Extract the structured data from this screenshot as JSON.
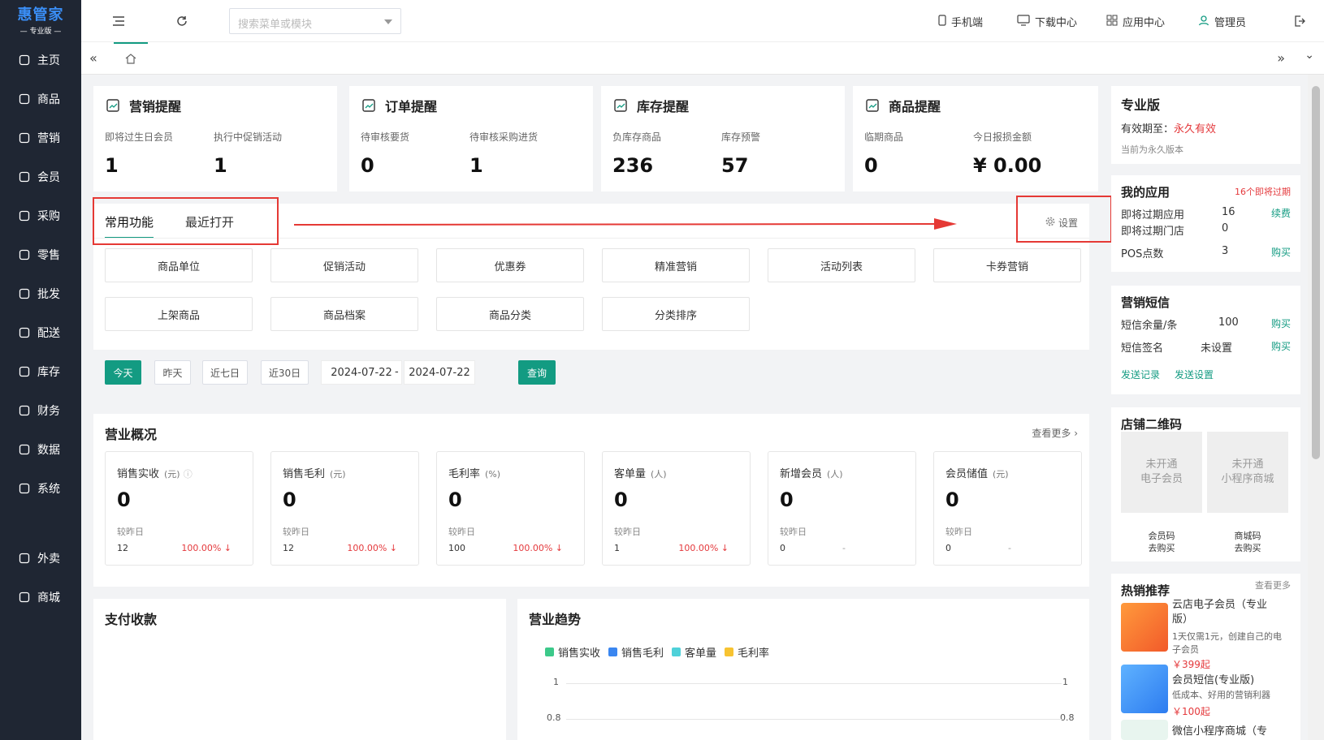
{
  "logo": {
    "brand": "惠管家",
    "edition": "专业版"
  },
  "nav": [
    {
      "label": "主页",
      "icon": "home-icon"
    },
    {
      "label": "商品",
      "icon": "cube-icon"
    },
    {
      "label": "营销",
      "icon": "chart-icon"
    },
    {
      "label": "会员",
      "icon": "heart-icon"
    },
    {
      "label": "采购",
      "icon": "clipboard-icon"
    },
    {
      "label": "零售",
      "icon": "bag-icon"
    },
    {
      "label": "批发",
      "icon": "building-icon"
    },
    {
      "label": "配送",
      "icon": "truck-icon"
    },
    {
      "label": "库存",
      "icon": "box-icon"
    },
    {
      "label": "财务",
      "icon": "finance-icon"
    },
    {
      "label": "数据",
      "icon": "data-icon"
    },
    {
      "label": "系统",
      "icon": "settings-icon"
    },
    {
      "label": "外卖",
      "icon": "delivery-icon"
    },
    {
      "label": "商城",
      "icon": "store-icon"
    }
  ],
  "topbar": {
    "search_placeholder": "搜索菜单或模块",
    "mobile": "手机端",
    "download": "下载中心",
    "apps": "应用中心",
    "user": "管理员"
  },
  "reminders": [
    {
      "title": "营销提醒",
      "icon": "trend-icon",
      "items": [
        {
          "label": "即将过生日会员",
          "value": "1"
        },
        {
          "label": "执行中促销活动",
          "value": "1"
        }
      ]
    },
    {
      "title": "订单提醒",
      "icon": "document-icon",
      "items": [
        {
          "label": "待审核要货",
          "value": "0"
        },
        {
          "label": "待审核采购进货",
          "value": "1"
        }
      ]
    },
    {
      "title": "库存提醒",
      "icon": "warehouse-icon",
      "items": [
        {
          "label": "负库存商品",
          "value": "236"
        },
        {
          "label": "库存预警",
          "value": "57"
        }
      ]
    },
    {
      "title": "商品提醒",
      "icon": "shopping-bag-icon",
      "items": [
        {
          "label": "临期商品",
          "value": "0"
        },
        {
          "label": "今日报损金额",
          "value": "¥ 0.00"
        }
      ]
    }
  ],
  "functions": {
    "tab_active": "常用功能",
    "tab_other": "最近打开",
    "settings": "设置",
    "buttons": [
      "商品单位",
      "促销活动",
      "优惠券",
      "精准营销",
      "活动列表",
      "卡券营销",
      "上架商品",
      "商品档案",
      "商品分类",
      "分类排序"
    ]
  },
  "date_filter": {
    "today": "今天",
    "yesterday": "昨天",
    "last7": "近七日",
    "last30": "近30日",
    "start": "2024-07-22",
    "sep": "-",
    "end": "2024-07-22",
    "query": "查询"
  },
  "overview": {
    "title": "营业概况",
    "more": "查看更多",
    "compare_label": "较昨日",
    "cards": [
      {
        "name": "销售实收",
        "unit": "(元)",
        "value": "0",
        "prev": "12",
        "change": "100.00% ↓"
      },
      {
        "name": "销售毛利",
        "unit": "(元)",
        "value": "0",
        "prev": "12",
        "change": "100.00% ↓"
      },
      {
        "name": "毛利率",
        "unit": "(%)",
        "value": "0",
        "prev": "100",
        "change": "100.00% ↓"
      },
      {
        "name": "客单量",
        "unit": "(人)",
        "value": "0",
        "prev": "1",
        "change": "100.00% ↓"
      },
      {
        "name": "新增会员",
        "unit": "(人)",
        "value": "0",
        "prev": "0",
        "change": "-"
      },
      {
        "name": "会员储值",
        "unit": "(元)",
        "value": "0",
        "prev": "0",
        "change": "-"
      }
    ]
  },
  "payment": {
    "title": "支付收款"
  },
  "trend": {
    "title": "营业趋势"
  },
  "chart_data": {
    "type": "line",
    "series": [
      {
        "name": "销售实收",
        "color": "#3cc98a",
        "values": []
      },
      {
        "name": "销售毛利",
        "color": "#3a86f0",
        "values": []
      },
      {
        "name": "客单量",
        "color": "#4fd1d9",
        "values": []
      },
      {
        "name": "毛利率",
        "color": "#f7c331",
        "values": []
      }
    ],
    "y_ticks_left": [
      "1",
      "0.8"
    ],
    "y_ticks_right": [
      "1",
      "0.8"
    ]
  },
  "pro": {
    "title": "专业版",
    "valid_label": "有效期至：",
    "valid_value": "永久有效",
    "note": "当前为永久版本"
  },
  "myapps": {
    "title": "我的应用",
    "expiring": "16个即将过期",
    "rows": [
      {
        "label": "即将过期应用",
        "value": "16",
        "action": "续费"
      },
      {
        "label": "即将过期门店",
        "value": "0",
        "action": ""
      },
      {
        "label": "POS点数",
        "value": "3",
        "action": "购买"
      }
    ]
  },
  "sms": {
    "title": "营销短信",
    "rows": [
      {
        "label": "短信余量/条",
        "value": "100",
        "action": "购买"
      },
      {
        "label": "短信签名",
        "value": "未设置",
        "action": "购买"
      }
    ],
    "send_record": "发送记录",
    "send_settings": "发送设置"
  },
  "qrcode": {
    "title": "店铺二维码",
    "items": [
      {
        "box": "未开通\n电子会员",
        "label": "会员码",
        "action": "去购买"
      },
      {
        "box": "未开通\n小程序商城",
        "label": "商城码",
        "action": "去购买"
      }
    ]
  },
  "hot": {
    "title": "热销推荐",
    "more": "查看更多",
    "items": [
      {
        "name": "云店电子会员（专业版）",
        "desc": "1天仅需1元，创建自己的电子会员",
        "price": "￥399起"
      },
      {
        "name": "会员短信(专业版)",
        "desc": "低成本、好用的营销利器",
        "price": "￥100起"
      },
      {
        "name": "微信小程序商城（专",
        "desc": "",
        "price": ""
      }
    ]
  }
}
